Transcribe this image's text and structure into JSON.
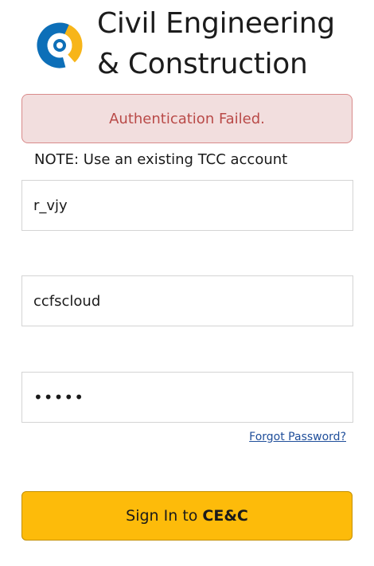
{
  "header": {
    "title": "Civil Engineering\n& Construction",
    "logo_icon": "trimble-connect-logo-icon"
  },
  "alert": {
    "message": "Authentication Failed."
  },
  "note": "NOTE: Use an existing TCC account",
  "form": {
    "username_value": "r_vjy",
    "tenant_value": "ccfscloud",
    "password_value": "•••••",
    "forgot_password": "Forgot Password?",
    "signin_prefix": "Sign In to",
    "signin_product": "CE&C"
  },
  "colors": {
    "alert_bg": "#f2dede",
    "alert_text": "#b94a48",
    "button": "#fdbb0a",
    "link": "#1f4e9a",
    "logo_blue": "#0d6fb8",
    "logo_yellow": "#f7b519"
  }
}
